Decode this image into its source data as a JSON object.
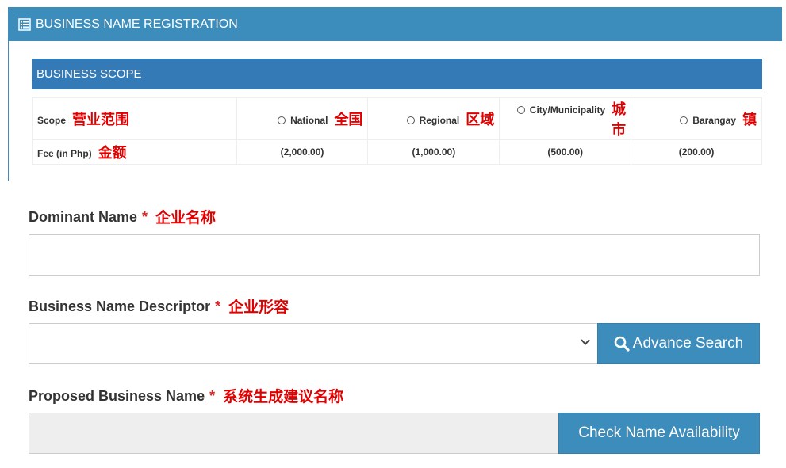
{
  "panel": {
    "title": "BUSINESS NAME REGISTRATION"
  },
  "scope_section": {
    "title": "BUSINESS SCOPE",
    "scope_label": "Scope",
    "scope_label_cn": "营业范围",
    "fee_label": "Fee (in Php)",
    "fee_label_cn": "金额",
    "options": [
      {
        "label": "National",
        "cn": "全国",
        "fee": "(2,000.00)"
      },
      {
        "label": "Regional",
        "cn": "区域",
        "fee": "(1,000.00)"
      },
      {
        "label": "City/Municipality",
        "cn": "城市",
        "fee": "(500.00)"
      },
      {
        "label": "Barangay",
        "cn": "镇",
        "fee": "(200.00)"
      }
    ]
  },
  "form": {
    "dominant_name": {
      "label": "Dominant Name",
      "required": "*",
      "cn": "企业名称",
      "value": ""
    },
    "descriptor": {
      "label": "Business Name Descriptor",
      "required": "*",
      "cn": "企业形容",
      "value": ""
    },
    "advance_search_label": "Advance Search",
    "proposed": {
      "label": "Proposed Business Name",
      "required": "*",
      "cn": "系统生成建议名称",
      "value": ""
    },
    "check_label": "Check Name Availability"
  },
  "colors": {
    "primary": "#3c8dbc",
    "scope_bar": "#337ab7",
    "annotation": "#e00000"
  }
}
